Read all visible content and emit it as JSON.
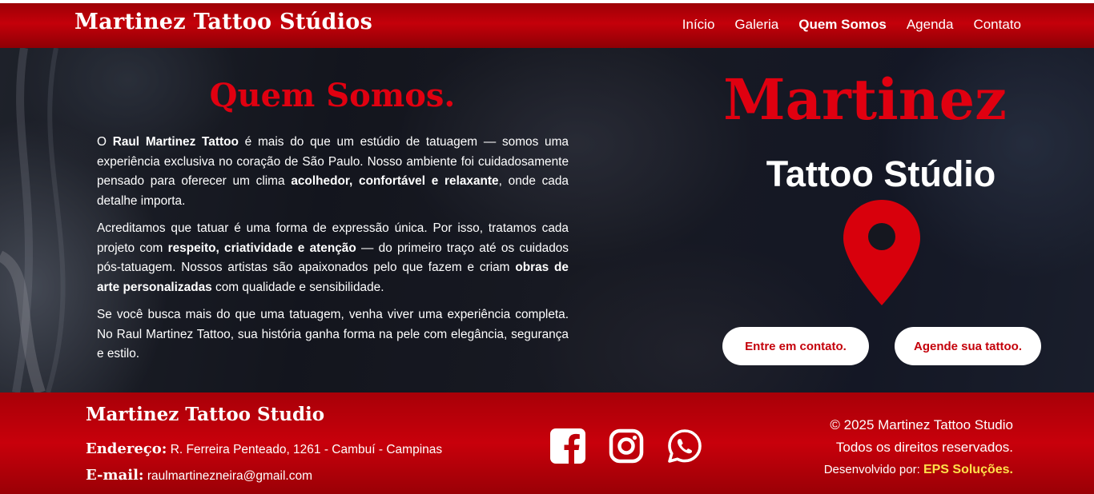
{
  "header": {
    "brand": "Martinez Tattoo Stúdios",
    "nav": [
      "Início",
      "Galeria",
      "Quem Somos",
      "Agenda",
      "Contato"
    ],
    "active_nav": "Quem Somos"
  },
  "about": {
    "title": "Quem Somos.",
    "p1": {
      "t1": "O ",
      "b1": "Raul Martinez Tattoo",
      "t2": " é mais do que um estúdio de tatuagem — somos uma experiência exclusiva no coração de São Paulo. Nosso ambiente foi cuidadosamente pensado para oferecer um clima ",
      "b2": "acolhedor, confortável e relaxante",
      "t3": ", onde cada detalhe importa."
    },
    "p2": {
      "t1": "Acreditamos que tatuar é uma forma de expressão única. Por isso, tratamos cada projeto com ",
      "b1": "respeito, criatividade e atenção",
      "t2": " — do primeiro traço até os cuidados pós-tatuagem. Nossos artistas são apaixonados pelo que fazem e criam ",
      "b2": "obras de arte personalizadas",
      "t3": " com qualidade e sensibilidade."
    },
    "p3": "Se você busca mais do que uma tatuagem, venha viver uma experiência completa. No Raul Martinez Tattoo, sua história ganha forma na pele com elegância, segurança e estilo."
  },
  "logo": {
    "word": "Martinez",
    "subtitle": "Tattoo Stúdio",
    "pin_icon": "location-pin-icon"
  },
  "buttons": {
    "contact": "Entre em contato.",
    "schedule": "Agende sua tattoo."
  },
  "footer": {
    "brand": "Martinez Tattoo Studio",
    "address_label": "Endereço:",
    "address": "R. Ferreira Penteado, 1261 - Cambuí - Campinas",
    "email_label": "E-mail:",
    "email": "raulmartinezneira@gmail.com",
    "social_icons": [
      "facebook-icon",
      "instagram-icon",
      "whatsapp-icon"
    ],
    "copyright": "© 2025 Martinez Tattoo Studio",
    "rights": "Todos os direitos reservados.",
    "dev_label": "Desenvolvido por:",
    "dev_name": "EPS Soluções."
  },
  "colors": {
    "brand_red": "#c4000a",
    "accent_red": "#e00010",
    "highlight_yellow": "#ffe14a"
  }
}
